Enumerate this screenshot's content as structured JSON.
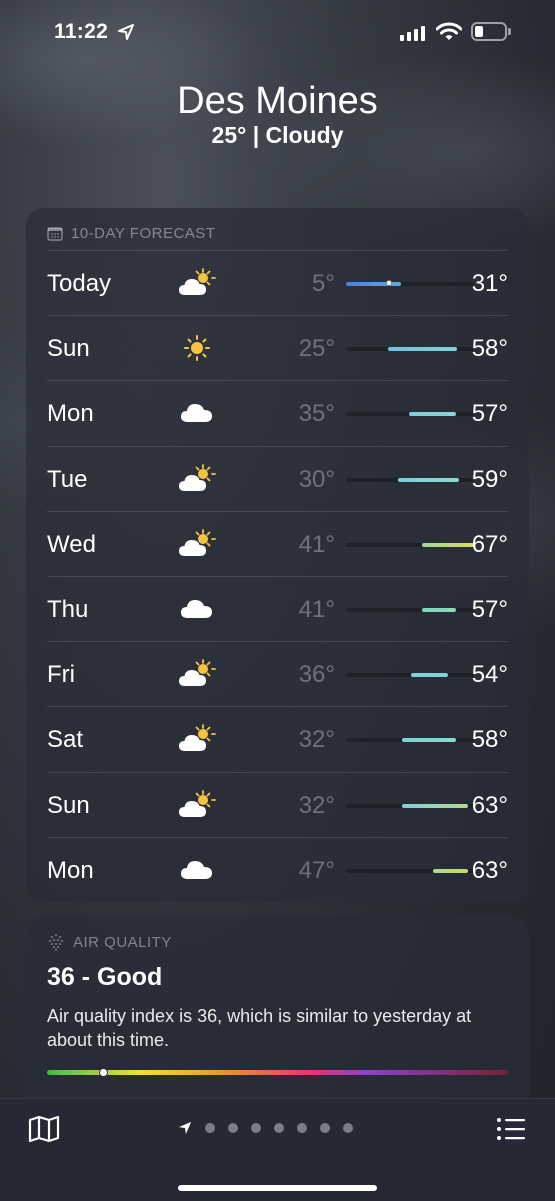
{
  "status_bar": {
    "time": "11:22",
    "battery_percent": 25
  },
  "header": {
    "city": "Des Moines",
    "summary": "25° | Cloudy"
  },
  "forecast": {
    "title": "10-DAY FORECAST",
    "days": [
      {
        "day": "Today",
        "icon": "partly-sunny-icon",
        "low": "5°",
        "high": "31°",
        "has_current_dot": true
      },
      {
        "day": "Sun",
        "icon": "sun-icon",
        "low": "25°",
        "high": "58°"
      },
      {
        "day": "Mon",
        "icon": "cloud-icon",
        "low": "35°",
        "high": "57°"
      },
      {
        "day": "Tue",
        "icon": "partly-sunny-icon",
        "low": "30°",
        "high": "59°"
      },
      {
        "day": "Wed",
        "icon": "partly-sunny-icon",
        "low": "41°",
        "high": "67°"
      },
      {
        "day": "Thu",
        "icon": "cloud-icon",
        "low": "41°",
        "high": "57°"
      },
      {
        "day": "Fri",
        "icon": "partly-sunny-icon",
        "low": "36°",
        "high": "54°"
      },
      {
        "day": "Sat",
        "icon": "partly-sunny-icon",
        "low": "32°",
        "high": "58°"
      },
      {
        "day": "Sun",
        "icon": "partly-sunny-icon",
        "low": "32°",
        "high": "63°"
      },
      {
        "day": "Mon",
        "icon": "cloud-icon",
        "low": "47°",
        "high": "63°"
      }
    ]
  },
  "air_quality": {
    "title": "AIR QUALITY",
    "value_label": "36 - Good",
    "description": "Air quality index is 36, which is similar to yesterday at about this time.",
    "index": 36
  },
  "toolbar": {
    "page_count": 8,
    "current_page": 0
  },
  "colors": {
    "cool": "#5b8de8",
    "mild": "#7fd1d8",
    "warm": "#c7d96a",
    "sun": "#f5c542"
  }
}
